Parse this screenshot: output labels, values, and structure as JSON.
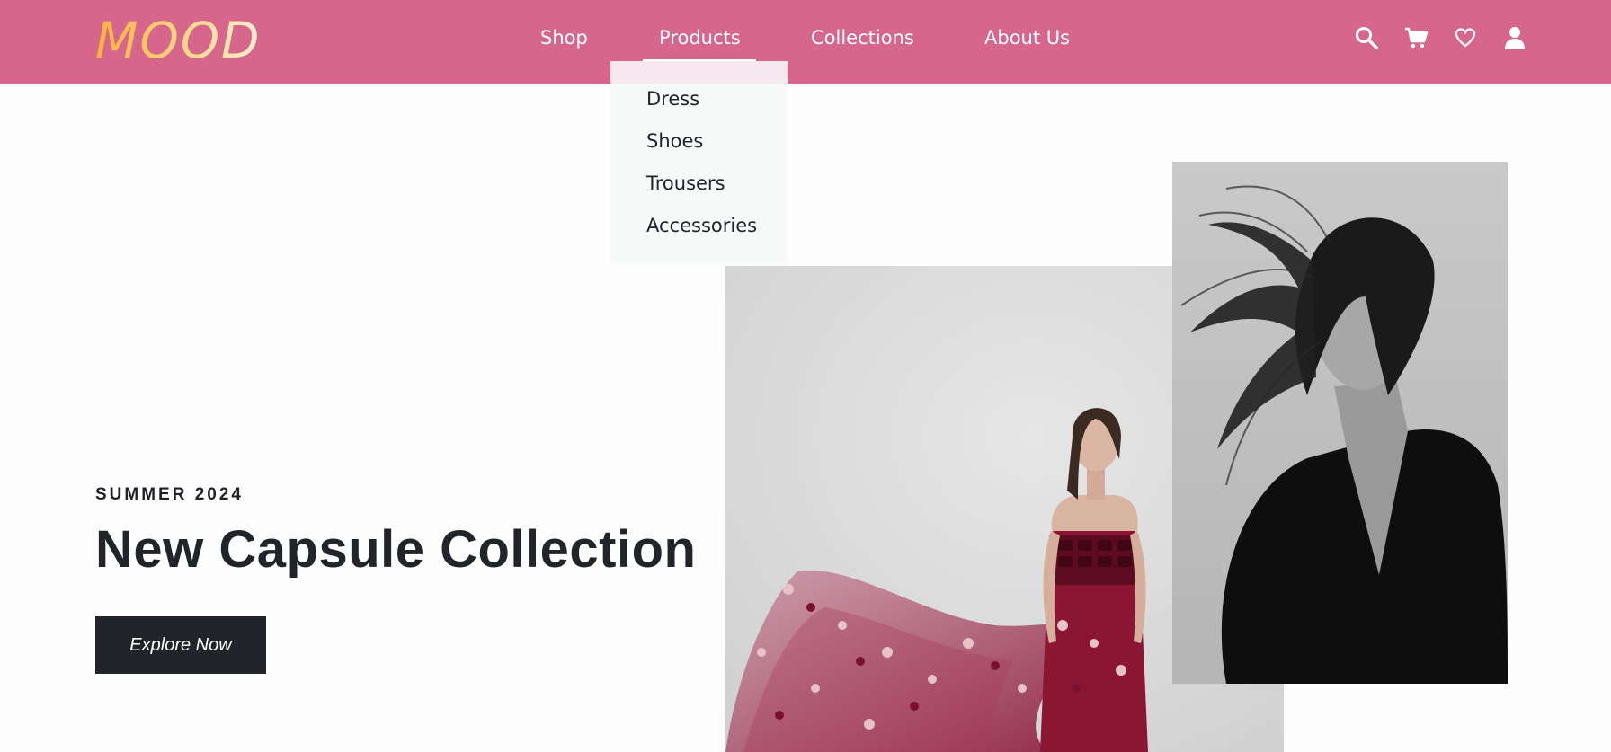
{
  "brand": {
    "logo_text": "MOOD",
    "header_color": "#d6668c",
    "logo_gradient": [
      "#ffb13b",
      "#fff0d2"
    ]
  },
  "nav": {
    "items": [
      {
        "label": "Shop"
      },
      {
        "label": "Products",
        "active": true
      },
      {
        "label": "Collections"
      },
      {
        "label": "About Us"
      }
    ]
  },
  "header_icons": [
    "search-icon",
    "cart-icon",
    "heart-icon",
    "user-icon"
  ],
  "dropdown": {
    "items": [
      {
        "label": "Dress"
      },
      {
        "label": "Shoes"
      },
      {
        "label": "Trousers"
      },
      {
        "label": "Accessories"
      }
    ]
  },
  "hero": {
    "eyebrow": "SUMMER 2024",
    "headline": "New Capsule Collection",
    "cta_label": "Explore Now",
    "cta_color": "#212529"
  }
}
